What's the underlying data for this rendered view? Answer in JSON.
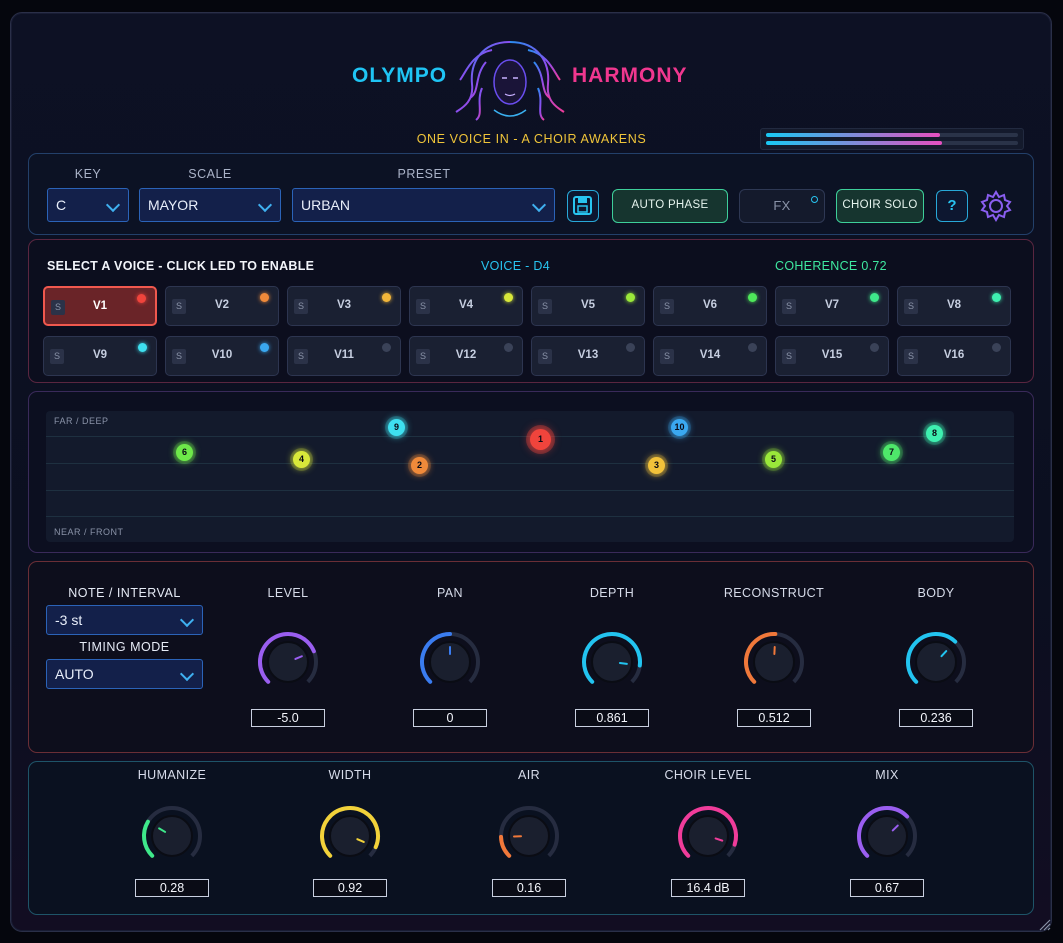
{
  "header": {
    "title_left": "OLYMPO",
    "title_right": "HARMONY",
    "tagline": "ONE VOICE IN - A CHOIR AWAKENS",
    "meter_levels": [
      0.69,
      0.7
    ]
  },
  "controls": {
    "key_label": "KEY",
    "key_value": "C",
    "scale_label": "SCALE",
    "scale_value": "MAYOR",
    "preset_label": "PRESET",
    "preset_value": "URBAN",
    "auto_phase_label": "AUTO PHASE",
    "fx_label": "FX",
    "choir_solo_label": "CHOIR SOLO",
    "help_label": "?"
  },
  "voices": {
    "instruction": "SELECT A VOICE - CLICK LED TO ENABLE",
    "current_voice": "VOICE - D4",
    "coherence": "COHERENCE 0.72",
    "solo_label": "S",
    "items": [
      {
        "name": "V1",
        "led": "#f0443c",
        "active": true
      },
      {
        "name": "V2",
        "led": "#f08a3a"
      },
      {
        "name": "V3",
        "led": "#f2b63a"
      },
      {
        "name": "V4",
        "led": "#d8e83a"
      },
      {
        "name": "V5",
        "led": "#9ae83a"
      },
      {
        "name": "V6",
        "led": "#4ee85a"
      },
      {
        "name": "V7",
        "led": "#3ee88a"
      },
      {
        "name": "V8",
        "led": "#3ef0b0"
      },
      {
        "name": "V9",
        "led": "#3ee0f0"
      },
      {
        "name": "V10",
        "led": "#3aa8f0"
      },
      {
        "name": "V11",
        "led": "#3a4258"
      },
      {
        "name": "V12",
        "led": "#3a4258"
      },
      {
        "name": "V13",
        "led": "#3a4258"
      },
      {
        "name": "V14",
        "led": "#3a4258"
      },
      {
        "name": "V15",
        "led": "#3a4258"
      },
      {
        "name": "V16",
        "led": "#3a4258"
      }
    ]
  },
  "stage": {
    "far_label": "FAR / DEEP",
    "near_label": "NEAR / FRONT",
    "dots": [
      {
        "label": "1",
        "color": "#f0443c"
      },
      {
        "label": "2",
        "color": "#f08a3a"
      },
      {
        "label": "3",
        "color": "#f2c23a"
      },
      {
        "label": "4",
        "color": "#d8e83a"
      },
      {
        "label": "5",
        "color": "#9ae83a"
      },
      {
        "label": "6",
        "color": "#6ee84a"
      },
      {
        "label": "7",
        "color": "#4ee86a"
      },
      {
        "label": "8",
        "color": "#3ef0b0"
      },
      {
        "label": "9",
        "color": "#3ee0f0"
      },
      {
        "label": "10",
        "color": "#3aa8f0"
      }
    ]
  },
  "voice_params": {
    "note_interval_label": "NOTE / INTERVAL",
    "note_interval_value": "-3 st",
    "timing_mode_label": "TIMING MODE",
    "timing_mode_value": "AUTO",
    "knobs": [
      {
        "label": "LEVEL",
        "value": "-5.0",
        "color": "#9a5ef0",
        "level": 0.75
      },
      {
        "label": "PAN",
        "value": "0",
        "color": "#3a7cf0",
        "level": 0.5
      },
      {
        "label": "DEPTH",
        "value": "0.861",
        "color": "#22c4f0",
        "level": 0.86
      },
      {
        "label": "RECONSTRUCT",
        "value": "0.512",
        "color": "#f0783a",
        "level": 0.51
      },
      {
        "label": "BODY",
        "value": "0.236",
        "color": "#22c4f0",
        "level": 0.66
      }
    ]
  },
  "global_params": {
    "knobs": [
      {
        "label": "HUMANIZE",
        "value": "0.28",
        "color": "#3ee88a",
        "level": 0.28
      },
      {
        "label": "WIDTH",
        "value": "0.92",
        "color": "#f2d23a",
        "level": 0.92
      },
      {
        "label": "AIR",
        "value": "0.16",
        "color": "#f0783a",
        "level": 0.16
      },
      {
        "label": "CHOIR LEVEL",
        "value": "16.4 dB",
        "color": "#f03c9a",
        "level": 0.9
      },
      {
        "label": "MIX",
        "value": "0.67",
        "color": "#9a5ef0",
        "level": 0.67
      }
    ]
  }
}
